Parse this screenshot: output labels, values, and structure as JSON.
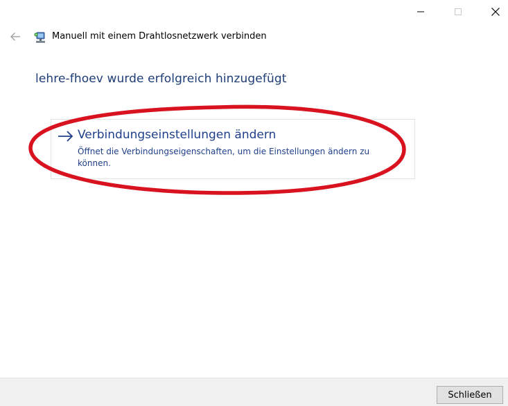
{
  "window": {
    "caption_buttons": {
      "minimize_icon": "minimize-icon",
      "maximize_icon": "maximize-icon",
      "close_icon": "close-icon"
    },
    "title": "Manuell mit einem Drahtlosnetzwerk verbinden",
    "back_icon": "back-arrow-icon",
    "wizard_icon": "wireless-network-icon"
  },
  "main": {
    "heading": "lehre-fhoev wurde erfolgreich hinzugefügt",
    "command_link": {
      "icon": "arrow-right-icon",
      "title": "Verbindungseinstellungen ändern",
      "description": "Öffnet die Verbindungseigenschaften, um die Einstellungen ändern zu können."
    }
  },
  "footer": {
    "close_label": "Schließen"
  },
  "colors": {
    "heading": "#1e3d78",
    "link": "#1f3f8a",
    "annotation_ellipse": "#d8121f",
    "footer_bg": "#f0f0f0"
  }
}
